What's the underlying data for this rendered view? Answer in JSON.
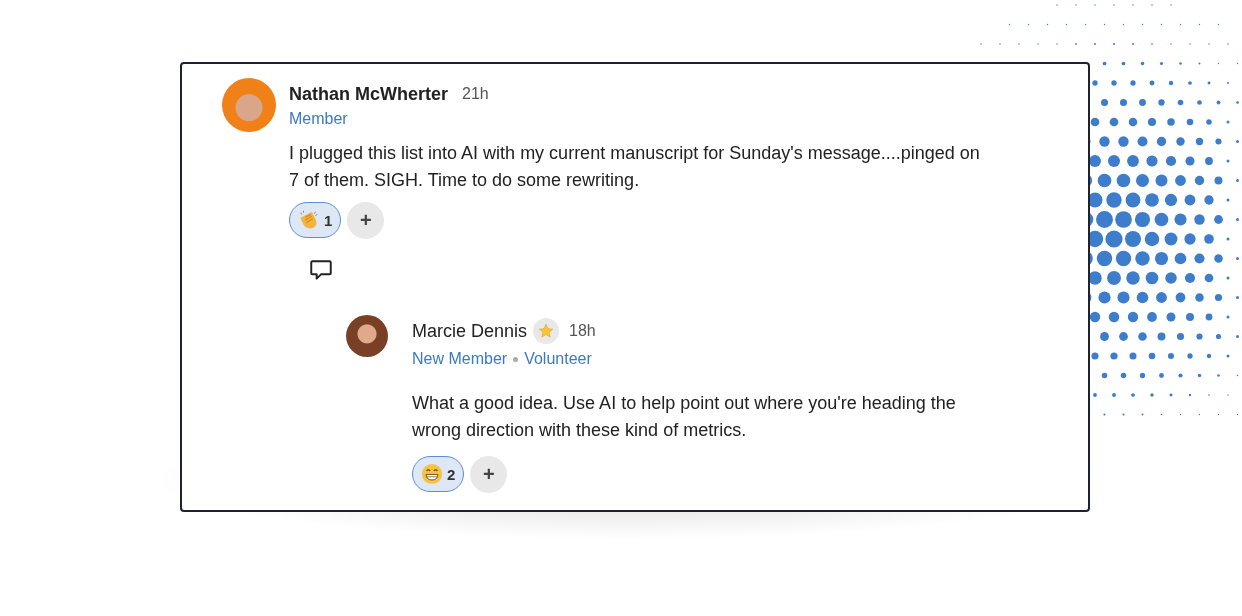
{
  "comment": {
    "author": "Nathan McWherter",
    "time": "21h",
    "roles": [
      "Member"
    ],
    "text": "I plugged this list into AI with my current manuscript for Sunday's message....pinged on 7 of them. SIGH. Time to do some rewriting.",
    "reactions": [
      {
        "kind": "clap",
        "count": "1",
        "selected": true
      }
    ],
    "add_reaction": "+",
    "replies": [
      {
        "author": "Marcie Dennis",
        "badge": {
          "kind": "star"
        },
        "time": "18h",
        "roles": [
          "New Member",
          "Volunteer"
        ],
        "text": "What a good idea. Use AI to help point out where you're heading the wrong direction with these kind of metrics.",
        "reactions": [
          {
            "kind": "grin",
            "count": "2",
            "selected": true
          }
        ],
        "add_reaction": "+"
      }
    ]
  }
}
